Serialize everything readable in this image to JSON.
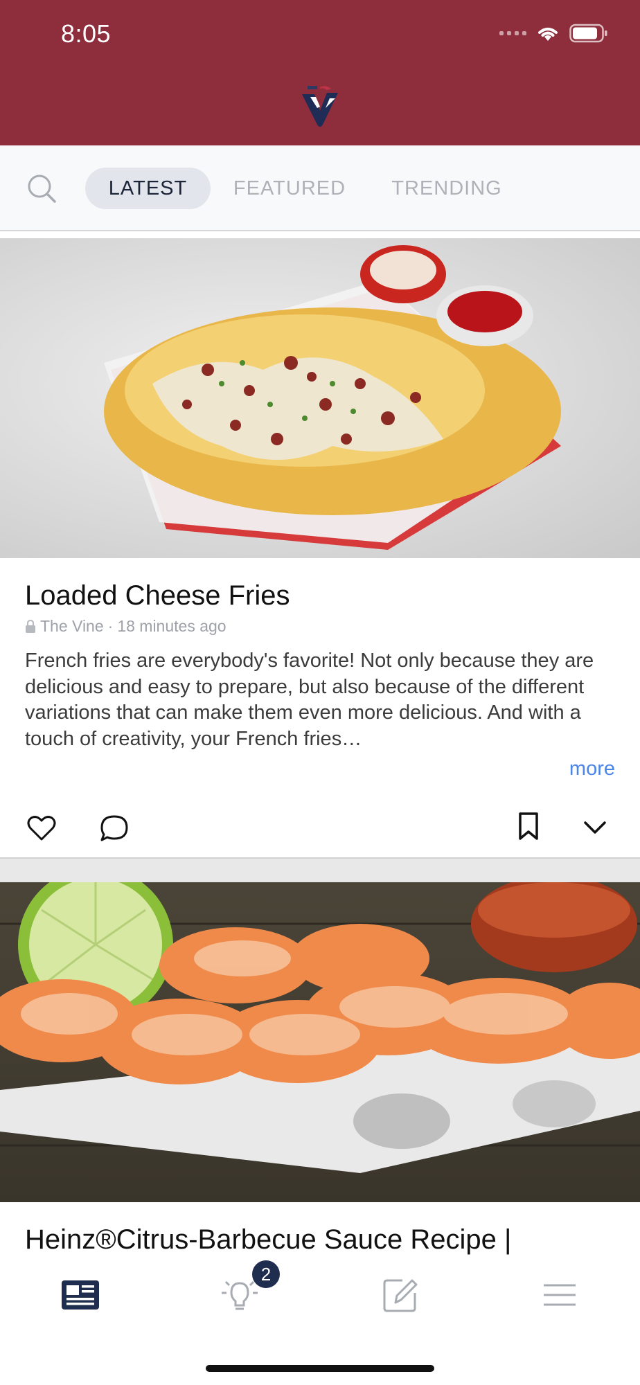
{
  "status_bar": {
    "time": "8:05"
  },
  "tabs": {
    "items": [
      "LATEST",
      "FEATURED",
      "TRENDING"
    ],
    "active": "LATEST"
  },
  "posts": [
    {
      "title": "Loaded Cheese Fries",
      "source": "The Vine",
      "time_ago": "18 minutes ago",
      "meta_separator": "·",
      "description": "French fries are everybody's favorite! Not only because they are delicious and easy to prepare, but also because of the different variations that can make them even more delicious. And with a touch of creativity, your French fries…",
      "more_label": "more"
    },
    {
      "title": "Heinz®Citrus-Barbecue Sauce Recipe |"
    }
  ],
  "bottom_nav": {
    "notifications_badge": "2"
  },
  "colors": {
    "header_bg": "#8e2d3b",
    "accent_blue": "#4a86e8",
    "nav_active": "#1f2d4f"
  }
}
